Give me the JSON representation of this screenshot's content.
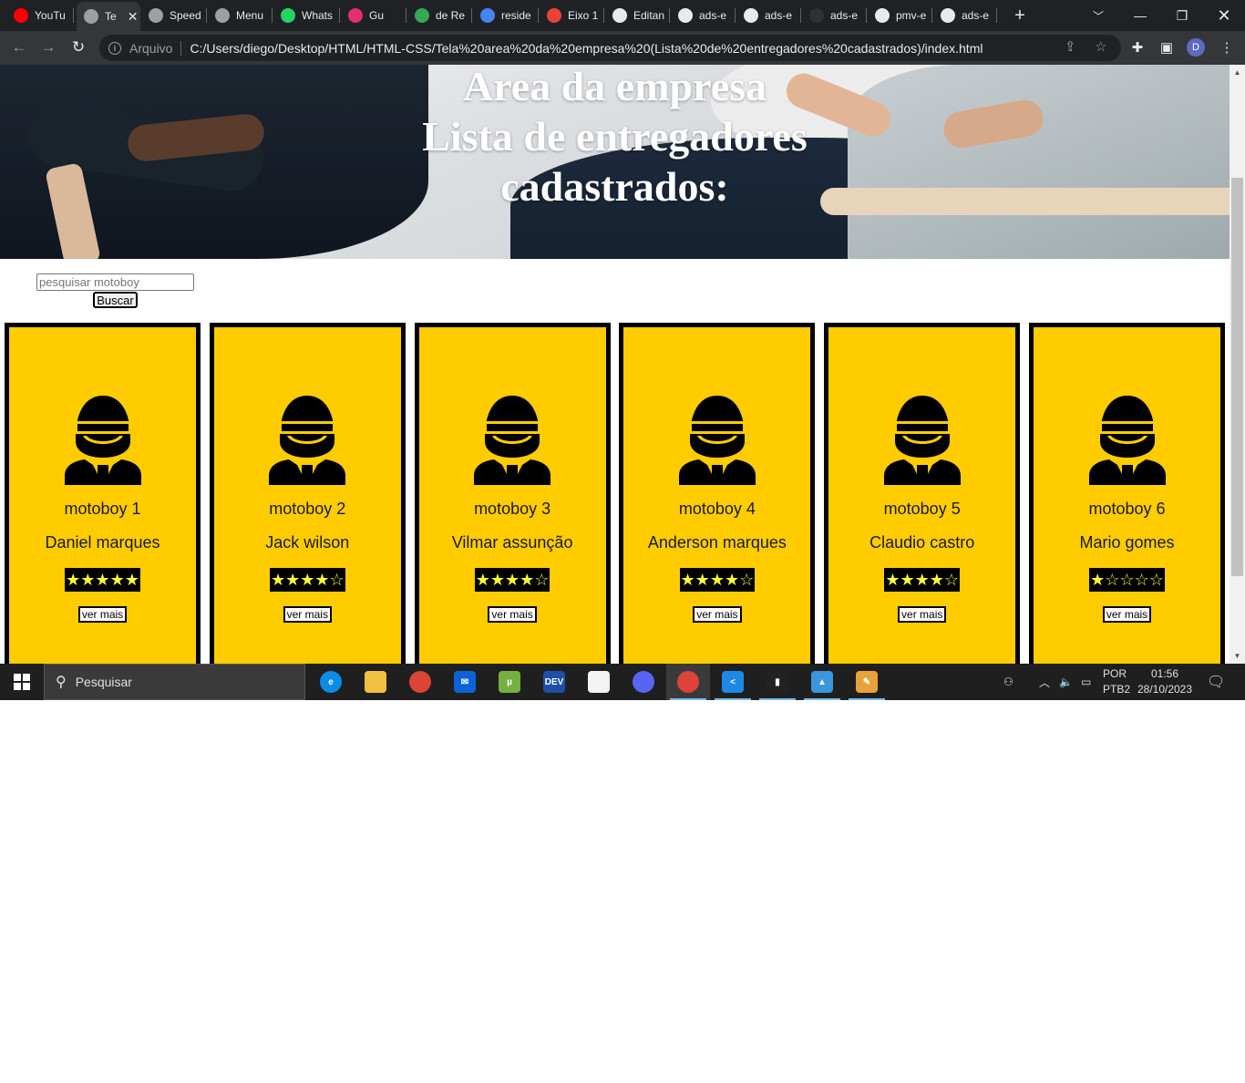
{
  "browser": {
    "tabs": [
      {
        "title": "YouTu",
        "favicon": "youtube-icon",
        "color": "#ff0000"
      },
      {
        "title": "Te",
        "favicon": "globe-icon",
        "color": "#9aa0a6",
        "active": true
      },
      {
        "title": "Speed",
        "favicon": "speed-icon",
        "color": "#9aa0a6"
      },
      {
        "title": "Menu",
        "favicon": "chatgpt-icon",
        "color": "#9aa0a6"
      },
      {
        "title": "Whats",
        "favicon": "whatsapp-icon",
        "color": "#25d366"
      },
      {
        "title": "Gu",
        "favicon": "instagram-icon",
        "color": "#e1306c"
      },
      {
        "title": "de Re",
        "favicon": "maps-icon",
        "color": "#34a853"
      },
      {
        "title": "reside",
        "favicon": "google-icon",
        "color": "#4285f4"
      },
      {
        "title": "Eixo 1",
        "favicon": "loading-icon",
        "color": "#ea4335"
      },
      {
        "title": "Editan",
        "favicon": "github-icon",
        "color": "#e8eaed"
      },
      {
        "title": "ads-e",
        "favicon": "github-icon",
        "color": "#e8eaed"
      },
      {
        "title": "ads-e",
        "favicon": "github-icon",
        "color": "#e8eaed"
      },
      {
        "title": "ads-e",
        "favicon": "github-dark-icon",
        "color": "#303134"
      },
      {
        "title": "pmv-e",
        "favicon": "github-icon",
        "color": "#e8eaed"
      },
      {
        "title": "ads-e",
        "favicon": "github-icon",
        "color": "#e8eaed"
      }
    ],
    "close_tab_symbol": "✕",
    "new_tab_symbol": "+",
    "address_scheme": "Arquivo",
    "address_url": "C:/Users/diego/Desktop/HTML/HTML-CSS/Tela%20area%20da%20empresa%20(Lista%20de%20entregadores%20cadastrados)/index.html",
    "profile_initial": "D"
  },
  "page": {
    "title_lines": [
      "Area da empresa",
      "Lista de entregadores",
      "cadastrados:"
    ],
    "search_placeholder": "pesquisar motoboy",
    "search_button": "Buscar",
    "accent_color": "#ffcc00",
    "star_color": "#ffff33",
    "couriers": [
      {
        "number_label": "motoboy 1",
        "name": "Daniel marques",
        "stars": "★★★★★",
        "rating": 5,
        "button": "ver mais"
      },
      {
        "number_label": "motoboy 2",
        "name": "Jack wilson",
        "stars": "★★★★☆",
        "rating": 4,
        "button": "ver mais"
      },
      {
        "number_label": "motoboy 3",
        "name": "Vilmar assunção",
        "stars": "★★★★☆",
        "rating": 4,
        "button": "ver mais"
      },
      {
        "number_label": "motoboy 4",
        "name": "Anderson marques",
        "stars": "★★★★☆",
        "rating": 4,
        "button": "ver mais"
      },
      {
        "number_label": "motoboy 5",
        "name": "Claudio castro",
        "stars": "★★★★☆",
        "rating": 4,
        "button": "ver mais"
      },
      {
        "number_label": "motoboy 6",
        "name": "Mario gomes",
        "stars": "★☆☆☆☆",
        "rating": 1,
        "button": "ver mais"
      }
    ]
  },
  "taskbar": {
    "search_placeholder": "Pesquisar",
    "apps": [
      {
        "name": "edge-icon",
        "color": "#0c8ce9",
        "label": "e"
      },
      {
        "name": "file-explorer-icon",
        "color": "#f0c040",
        "label": ""
      },
      {
        "name": "chrome-icon",
        "color": "#db4437",
        "label": ""
      },
      {
        "name": "mail-icon",
        "color": "#0a64d8",
        "label": "✉"
      },
      {
        "name": "utorrent-icon",
        "color": "#76b041",
        "label": "µ"
      },
      {
        "name": "devtoys-icon",
        "color": "#1e4fa8",
        "label": "DEV"
      },
      {
        "name": "store-icon",
        "color": "#f3f3f3",
        "label": ""
      },
      {
        "name": "discord-icon",
        "color": "#5865f2",
        "label": ""
      },
      {
        "name": "chrome-profile-icon",
        "color": "#db4437",
        "label": "",
        "active": true
      },
      {
        "name": "vscode-icon",
        "color": "#1e88e5",
        "label": "<"
      },
      {
        "name": "deezer-icon",
        "color": "#222222",
        "label": "▮"
      },
      {
        "name": "photos-icon",
        "color": "#3a96dd",
        "label": "▲"
      },
      {
        "name": "paint-icon",
        "color": "#e8a23c",
        "label": "✎"
      }
    ],
    "language_line1": "POR",
    "language_line2": "PTB2",
    "time": "01:56",
    "date": "28/10/2023"
  }
}
